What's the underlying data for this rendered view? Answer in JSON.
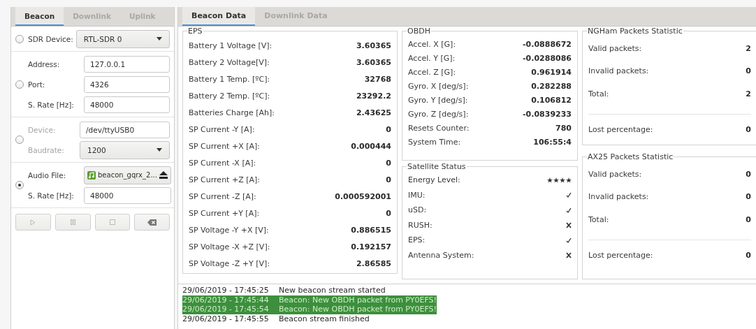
{
  "left_tabs": [
    {
      "label": "Beacon",
      "selected": true
    },
    {
      "label": "Downlink",
      "selected": false
    },
    {
      "label": "Uplink",
      "selected": false
    }
  ],
  "sources": [
    {
      "kind": "sdr",
      "selected": false,
      "disabled": false,
      "fields": [
        {
          "kind": "dropdown",
          "label": "SDR Device:",
          "value": "RTL-SDR 0"
        }
      ]
    },
    {
      "kind": "network",
      "selected": false,
      "disabled": false,
      "fields": [
        {
          "kind": "text",
          "label": "Address:",
          "value": "127.0.0.1"
        },
        {
          "kind": "text",
          "label": "Port:",
          "value": "4326"
        },
        {
          "kind": "text",
          "label": "S. Rate [Hz]:",
          "value": "48000"
        }
      ]
    },
    {
      "kind": "serial",
      "selected": false,
      "disabled": true,
      "fields": [
        {
          "kind": "text",
          "label": "Device:",
          "value": "/dev/ttyUSB0"
        },
        {
          "kind": "dropdown",
          "label": "Baudrate:",
          "value": "1200"
        }
      ]
    },
    {
      "kind": "audio",
      "selected": true,
      "disabled": false,
      "fields": [
        {
          "kind": "file",
          "label": "Audio File:",
          "value": "beacon_gqrx_2..."
        },
        {
          "kind": "text",
          "label": "S. Rate [Hz]:",
          "value": "48000"
        }
      ]
    }
  ],
  "controls": [
    {
      "kind": "play",
      "disabled": true
    },
    {
      "kind": "pause",
      "disabled": true
    },
    {
      "kind": "stop",
      "disabled": true
    },
    {
      "kind": "clear",
      "disabled": false
    }
  ],
  "data_tabs": [
    {
      "label": "Beacon Data",
      "selected": true
    },
    {
      "label": "Downlink Data",
      "selected": false
    }
  ],
  "eps": {
    "title": "EPS",
    "rows": [
      {
        "label": "Battery 1 Voltage [V]:",
        "value": "3.60365"
      },
      {
        "label": "Battery 2 Voltage[V]:",
        "value": "3.60365"
      },
      {
        "label": "Battery 1 Temp. [ºC]:",
        "value": "32768"
      },
      {
        "label": "Battery 2 Temp. [ºC]:",
        "value": "23292.2"
      },
      {
        "label": "Batteries Charge [Ah]:",
        "value": "2.43625"
      },
      {
        "label": "SP Current -Y [A]:",
        "value": "0"
      },
      {
        "label": "SP Current +X [A]:",
        "value": "0.000444"
      },
      {
        "label": "SP Current -X [A]:",
        "value": "0"
      },
      {
        "label": "SP Current +Z [A]:",
        "value": "0"
      },
      {
        "label": "SP Current -Z [A]:",
        "value": "0.000592001"
      },
      {
        "label": "SP Current +Y [A]:",
        "value": "0"
      },
      {
        "label": "SP Voltage -Y +X [V]:",
        "value": "0.886515"
      },
      {
        "label": "SP Voltage -X +Z [V]:",
        "value": "0.192157"
      },
      {
        "label": "SP Voltage -Z +Y [V]:",
        "value": "2.86585"
      }
    ]
  },
  "obdh": {
    "title": "OBDH",
    "rows": [
      {
        "label": "Accel. X [G]:",
        "value": "-0.0888672"
      },
      {
        "label": "Accel. Y [G]:",
        "value": "-0.0288086"
      },
      {
        "label": "Accel. Z [G]:",
        "value": "0.961914"
      },
      {
        "label": "Gyro. X [deg/s]:",
        "value": "0.282288"
      },
      {
        "label": "Gyro. Y [deg/s]:",
        "value": "0.106812"
      },
      {
        "label": "Gyro. Z [deg/s]:",
        "value": "-0.0839233"
      },
      {
        "label": "Resets Counter:",
        "value": "780"
      },
      {
        "label": "System Time:",
        "value": "106:55:4"
      }
    ]
  },
  "satellite_status": {
    "title": "Satellite Status",
    "rows": [
      {
        "kind": "stars",
        "label": "Energy Level:",
        "stars": 4
      },
      {
        "kind": "status",
        "label": "IMU:",
        "ok": true
      },
      {
        "kind": "status",
        "label": "uSD:",
        "ok": true
      },
      {
        "kind": "status",
        "label": "RUSH:",
        "ok": false
      },
      {
        "kind": "status",
        "label": "EPS:",
        "ok": true
      },
      {
        "kind": "status",
        "label": "Antenna System:",
        "ok": false
      }
    ]
  },
  "stats": [
    {
      "title": "NGHam Packets Statistic",
      "rows": [
        {
          "label": "Valid packets:",
          "value": "2"
        },
        {
          "label": "Invalid packets:",
          "value": "0"
        },
        {
          "label": "Total:",
          "value": "2"
        }
      ],
      "lost": {
        "label": "Lost percentage:",
        "value": "0"
      }
    },
    {
      "title": "AX25 Packets Statistic",
      "rows": [
        {
          "label": "Valid packets:",
          "value": "0"
        },
        {
          "label": "Invalid packets:",
          "value": "0"
        },
        {
          "label": "Total:",
          "value": "0"
        }
      ],
      "lost": {
        "label": "Lost percentage:",
        "value": "0"
      }
    }
  ],
  "log": [
    {
      "time": "29/06/2019 - 17:45:25",
      "message": "New beacon stream started",
      "selected": false
    },
    {
      "time": "29/06/2019 - 17:45:44",
      "message": "Beacon: New OBDH packet from PY0EFS!",
      "selected": true
    },
    {
      "time": "29/06/2019 - 17:45:54",
      "message": "Beacon: New OBDH packet from PY0EFS!",
      "selected": true
    },
    {
      "time": "29/06/2019 - 17:45:55",
      "message": "Beacon stream finished",
      "selected": false
    }
  ]
}
